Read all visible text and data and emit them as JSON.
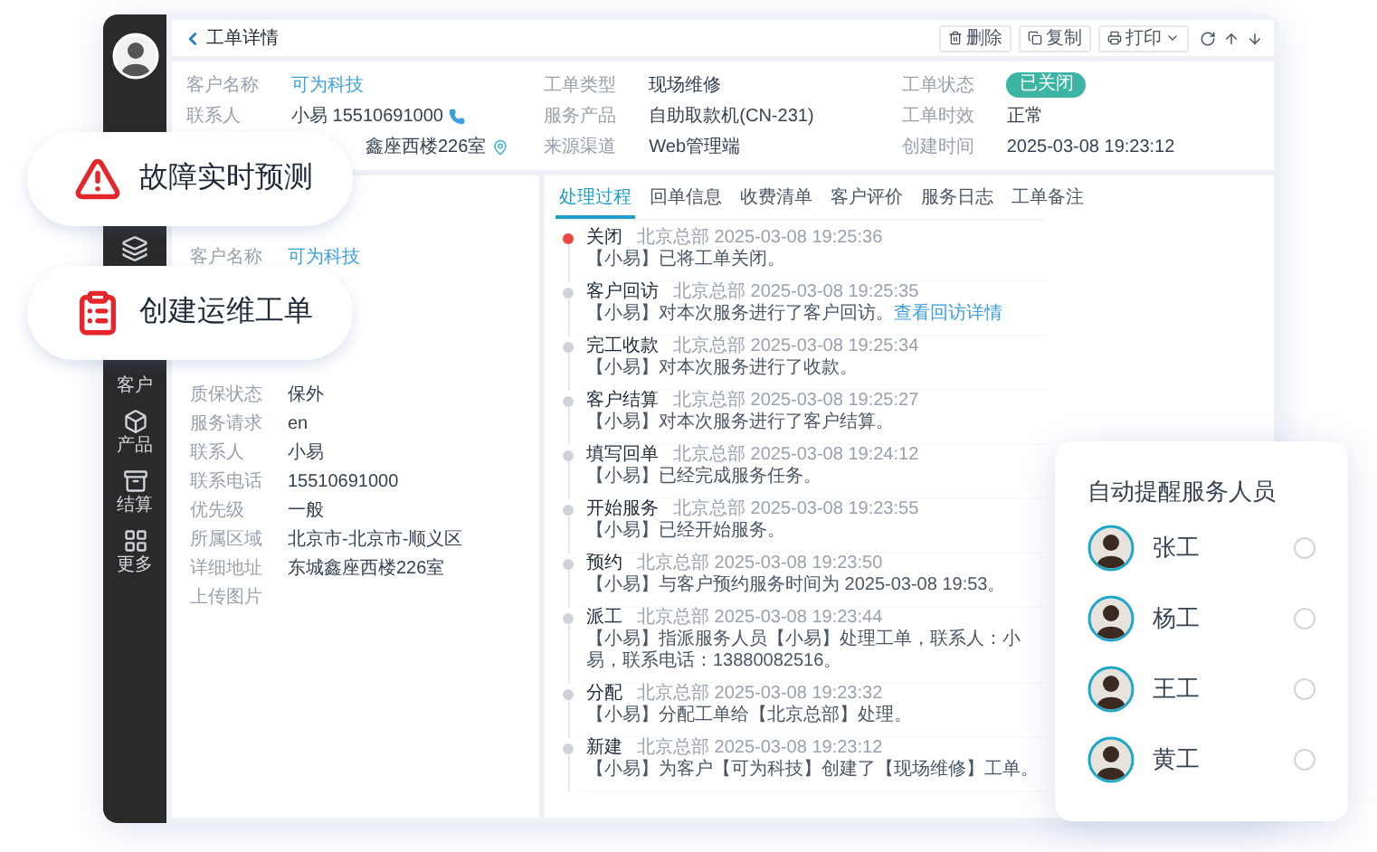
{
  "sidebar": {
    "items": [
      {
        "label": "客户"
      },
      {
        "label": "产品"
      },
      {
        "label": "结算"
      },
      {
        "label": "更多"
      }
    ]
  },
  "header": {
    "title": "工单详情",
    "buttons": [
      {
        "label": "删除",
        "kind": "delete"
      },
      {
        "label": "复制",
        "kind": "copy"
      },
      {
        "label": "打印",
        "kind": "print"
      }
    ]
  },
  "info": {
    "fields": [
      {
        "label": "客户名称",
        "value": "可为科技",
        "kind": "link"
      },
      {
        "label": "工单类型",
        "value": "现场维修",
        "kind": "text"
      },
      {
        "label": "工单状态",
        "value": "已关闭",
        "kind": "badge"
      },
      {
        "label": "联系人",
        "value": "小易 15510691000",
        "kind": "phone"
      },
      {
        "label": "服务产品",
        "value": "自助取款机(CN-231)",
        "kind": "text"
      },
      {
        "label": "工单时效",
        "value": "正常",
        "kind": "text"
      },
      {
        "value": "鑫座西楼226室",
        "kind": "location"
      },
      {
        "label": "来源渠道",
        "value": "Web管理端",
        "kind": "text"
      },
      {
        "label": "创建时间",
        "value": "2025-03-08 19:23:12",
        "kind": "text"
      }
    ]
  },
  "details": {
    "rows": [
      {
        "label": "客户名称",
        "value": "可为科技",
        "kind": "link"
      },
      {
        "label": "质保状态",
        "value": "保外",
        "kind": "text"
      },
      {
        "label": "服务请求",
        "value": "en",
        "kind": "text"
      },
      {
        "label": "联系人",
        "value": "小易",
        "kind": "text"
      },
      {
        "label": "联系电话",
        "value": "15510691000",
        "kind": "text"
      },
      {
        "label": "优先级",
        "value": "一般",
        "kind": "text"
      },
      {
        "label": "所属区域",
        "value": "北京市-北京市-顺义区",
        "kind": "text"
      },
      {
        "label": "详细地址",
        "value": "东城鑫座西楼226室",
        "kind": "text"
      },
      {
        "label": "上传图片",
        "kind": "text"
      }
    ]
  },
  "tabs": [
    {
      "label": "处理过程",
      "selected": true
    },
    {
      "label": "回单信息",
      "selected": false
    },
    {
      "label": "收费清单",
      "selected": false
    },
    {
      "label": "客户评价",
      "selected": false
    },
    {
      "label": "服务日志",
      "selected": false
    },
    {
      "label": "工单备注",
      "selected": false
    }
  ],
  "timeline": [
    {
      "title": "关闭",
      "message": "【小易】已将工单关闭。",
      "meta": "北京总部 2025-03-08 19:25:36",
      "latest": true
    },
    {
      "title": "客户回访",
      "message": "【小易】对本次服务进行了客户回访。",
      "link": "查看回访详情",
      "meta": "北京总部 2025-03-08 19:25:35",
      "latest": false
    },
    {
      "title": "完工收款",
      "message": "【小易】对本次服务进行了收款。",
      "meta": "北京总部 2025-03-08 19:25:34",
      "latest": false
    },
    {
      "title": "客户结算",
      "message": "【小易】对本次服务进行了客户结算。",
      "meta": "北京总部 2025-03-08 19:25:27",
      "latest": false
    },
    {
      "title": "填写回单",
      "message": "【小易】已经完成服务任务。",
      "meta": "北京总部 2025-03-08 19:24:12",
      "latest": false
    },
    {
      "title": "开始服务",
      "message": "【小易】已经开始服务。",
      "meta": "北京总部 2025-03-08 19:23:55",
      "latest": false
    },
    {
      "title": "预约",
      "message": "【小易】与客户预约服务时间为 2025-03-08 19:53。",
      "meta": "北京总部 2025-03-08 19:23:50",
      "latest": false
    },
    {
      "title": "派工",
      "message": "【小易】指派服务人员【小易】处理工单，联系人：小易，联系电话：13880082516。",
      "meta": "北京总部 2025-03-08 19:23:44",
      "latest": false
    },
    {
      "title": "分配",
      "message": "【小易】分配工单给【北京总部】处理。",
      "meta": "北京总部 2025-03-08 19:23:32",
      "latest": false
    },
    {
      "title": "新建",
      "message": "【小易】为客户【可为科技】创建了【现场维修】工单。",
      "meta": "北京总部 2025-03-08 19:23:12",
      "latest": false
    }
  ],
  "features": [
    {
      "label": "故障实时预测",
      "kind": "warning"
    },
    {
      "label": "创建运维工单",
      "kind": "clipboard"
    }
  ],
  "reminder": {
    "title": "自动提醒服务人员",
    "people": [
      {
        "name": "张工",
        "selected": false
      },
      {
        "name": "杨工",
        "selected": false
      },
      {
        "name": "王工",
        "selected": false
      },
      {
        "name": "黄工",
        "selected": false
      }
    ]
  }
}
